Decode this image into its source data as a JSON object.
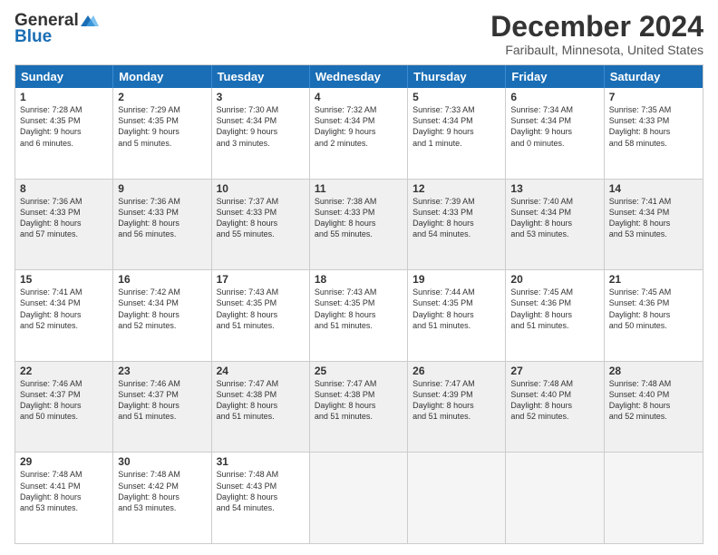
{
  "header": {
    "logo_general": "General",
    "logo_blue": "Blue",
    "month_title": "December 2024",
    "location": "Faribault, Minnesota, United States"
  },
  "weekdays": [
    "Sunday",
    "Monday",
    "Tuesday",
    "Wednesday",
    "Thursday",
    "Friday",
    "Saturday"
  ],
  "rows": [
    [
      {
        "day": "1",
        "lines": [
          "Sunrise: 7:28 AM",
          "Sunset: 4:35 PM",
          "Daylight: 9 hours",
          "and 6 minutes."
        ],
        "shaded": false
      },
      {
        "day": "2",
        "lines": [
          "Sunrise: 7:29 AM",
          "Sunset: 4:35 PM",
          "Daylight: 9 hours",
          "and 5 minutes."
        ],
        "shaded": false
      },
      {
        "day": "3",
        "lines": [
          "Sunrise: 7:30 AM",
          "Sunset: 4:34 PM",
          "Daylight: 9 hours",
          "and 3 minutes."
        ],
        "shaded": false
      },
      {
        "day": "4",
        "lines": [
          "Sunrise: 7:32 AM",
          "Sunset: 4:34 PM",
          "Daylight: 9 hours",
          "and 2 minutes."
        ],
        "shaded": false
      },
      {
        "day": "5",
        "lines": [
          "Sunrise: 7:33 AM",
          "Sunset: 4:34 PM",
          "Daylight: 9 hours",
          "and 1 minute."
        ],
        "shaded": false
      },
      {
        "day": "6",
        "lines": [
          "Sunrise: 7:34 AM",
          "Sunset: 4:34 PM",
          "Daylight: 9 hours",
          "and 0 minutes."
        ],
        "shaded": false
      },
      {
        "day": "7",
        "lines": [
          "Sunrise: 7:35 AM",
          "Sunset: 4:33 PM",
          "Daylight: 8 hours",
          "and 58 minutes."
        ],
        "shaded": false
      }
    ],
    [
      {
        "day": "8",
        "lines": [
          "Sunrise: 7:36 AM",
          "Sunset: 4:33 PM",
          "Daylight: 8 hours",
          "and 57 minutes."
        ],
        "shaded": true
      },
      {
        "day": "9",
        "lines": [
          "Sunrise: 7:36 AM",
          "Sunset: 4:33 PM",
          "Daylight: 8 hours",
          "and 56 minutes."
        ],
        "shaded": true
      },
      {
        "day": "10",
        "lines": [
          "Sunrise: 7:37 AM",
          "Sunset: 4:33 PM",
          "Daylight: 8 hours",
          "and 55 minutes."
        ],
        "shaded": true
      },
      {
        "day": "11",
        "lines": [
          "Sunrise: 7:38 AM",
          "Sunset: 4:33 PM",
          "Daylight: 8 hours",
          "and 55 minutes."
        ],
        "shaded": true
      },
      {
        "day": "12",
        "lines": [
          "Sunrise: 7:39 AM",
          "Sunset: 4:33 PM",
          "Daylight: 8 hours",
          "and 54 minutes."
        ],
        "shaded": true
      },
      {
        "day": "13",
        "lines": [
          "Sunrise: 7:40 AM",
          "Sunset: 4:34 PM",
          "Daylight: 8 hours",
          "and 53 minutes."
        ],
        "shaded": true
      },
      {
        "day": "14",
        "lines": [
          "Sunrise: 7:41 AM",
          "Sunset: 4:34 PM",
          "Daylight: 8 hours",
          "and 53 minutes."
        ],
        "shaded": true
      }
    ],
    [
      {
        "day": "15",
        "lines": [
          "Sunrise: 7:41 AM",
          "Sunset: 4:34 PM",
          "Daylight: 8 hours",
          "and 52 minutes."
        ],
        "shaded": false
      },
      {
        "day": "16",
        "lines": [
          "Sunrise: 7:42 AM",
          "Sunset: 4:34 PM",
          "Daylight: 8 hours",
          "and 52 minutes."
        ],
        "shaded": false
      },
      {
        "day": "17",
        "lines": [
          "Sunrise: 7:43 AM",
          "Sunset: 4:35 PM",
          "Daylight: 8 hours",
          "and 51 minutes."
        ],
        "shaded": false
      },
      {
        "day": "18",
        "lines": [
          "Sunrise: 7:43 AM",
          "Sunset: 4:35 PM",
          "Daylight: 8 hours",
          "and 51 minutes."
        ],
        "shaded": false
      },
      {
        "day": "19",
        "lines": [
          "Sunrise: 7:44 AM",
          "Sunset: 4:35 PM",
          "Daylight: 8 hours",
          "and 51 minutes."
        ],
        "shaded": false
      },
      {
        "day": "20",
        "lines": [
          "Sunrise: 7:45 AM",
          "Sunset: 4:36 PM",
          "Daylight: 8 hours",
          "and 51 minutes."
        ],
        "shaded": false
      },
      {
        "day": "21",
        "lines": [
          "Sunrise: 7:45 AM",
          "Sunset: 4:36 PM",
          "Daylight: 8 hours",
          "and 50 minutes."
        ],
        "shaded": false
      }
    ],
    [
      {
        "day": "22",
        "lines": [
          "Sunrise: 7:46 AM",
          "Sunset: 4:37 PM",
          "Daylight: 8 hours",
          "and 50 minutes."
        ],
        "shaded": true
      },
      {
        "day": "23",
        "lines": [
          "Sunrise: 7:46 AM",
          "Sunset: 4:37 PM",
          "Daylight: 8 hours",
          "and 51 minutes."
        ],
        "shaded": true
      },
      {
        "day": "24",
        "lines": [
          "Sunrise: 7:47 AM",
          "Sunset: 4:38 PM",
          "Daylight: 8 hours",
          "and 51 minutes."
        ],
        "shaded": true
      },
      {
        "day": "25",
        "lines": [
          "Sunrise: 7:47 AM",
          "Sunset: 4:38 PM",
          "Daylight: 8 hours",
          "and 51 minutes."
        ],
        "shaded": true
      },
      {
        "day": "26",
        "lines": [
          "Sunrise: 7:47 AM",
          "Sunset: 4:39 PM",
          "Daylight: 8 hours",
          "and 51 minutes."
        ],
        "shaded": true
      },
      {
        "day": "27",
        "lines": [
          "Sunrise: 7:48 AM",
          "Sunset: 4:40 PM",
          "Daylight: 8 hours",
          "and 52 minutes."
        ],
        "shaded": true
      },
      {
        "day": "28",
        "lines": [
          "Sunrise: 7:48 AM",
          "Sunset: 4:40 PM",
          "Daylight: 8 hours",
          "and 52 minutes."
        ],
        "shaded": true
      }
    ],
    [
      {
        "day": "29",
        "lines": [
          "Sunrise: 7:48 AM",
          "Sunset: 4:41 PM",
          "Daylight: 8 hours",
          "and 53 minutes."
        ],
        "shaded": false
      },
      {
        "day": "30",
        "lines": [
          "Sunrise: 7:48 AM",
          "Sunset: 4:42 PM",
          "Daylight: 8 hours",
          "and 53 minutes."
        ],
        "shaded": false
      },
      {
        "day": "31",
        "lines": [
          "Sunrise: 7:48 AM",
          "Sunset: 4:43 PM",
          "Daylight: 8 hours",
          "and 54 minutes."
        ],
        "shaded": false
      },
      {
        "day": "",
        "lines": [],
        "shaded": false,
        "empty": true
      },
      {
        "day": "",
        "lines": [],
        "shaded": false,
        "empty": true
      },
      {
        "day": "",
        "lines": [],
        "shaded": false,
        "empty": true
      },
      {
        "day": "",
        "lines": [],
        "shaded": false,
        "empty": true
      }
    ]
  ]
}
